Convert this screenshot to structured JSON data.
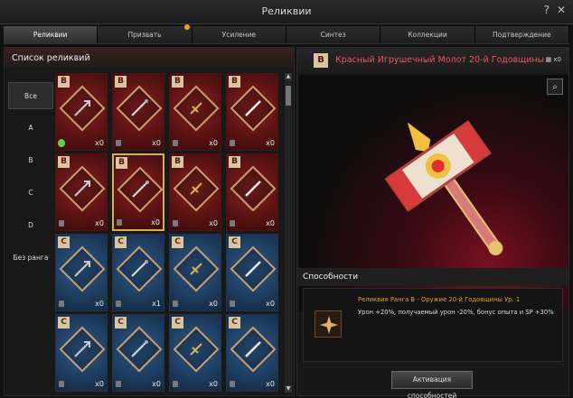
{
  "window": {
    "title": "Реликвии",
    "help": "?",
    "close": "✕"
  },
  "tabs": [
    {
      "label": "Реликвии",
      "active": true
    },
    {
      "label": "Призвать",
      "active": false,
      "notify": true
    },
    {
      "label": "Усиление",
      "active": false
    },
    {
      "label": "Синтез",
      "active": false
    },
    {
      "label": "Коллекции",
      "active": false
    },
    {
      "label": "Подтверждение",
      "active": false
    }
  ],
  "list": {
    "header": "Список реликвий",
    "ranks": [
      "Все",
      "A",
      "B",
      "C",
      "D",
      "Без ранга"
    ],
    "cards": [
      {
        "rank": "B",
        "color": "red",
        "qty": "x0",
        "gem": true
      },
      {
        "rank": "B",
        "color": "red",
        "qty": "x0"
      },
      {
        "rank": "B",
        "color": "red",
        "qty": "x0"
      },
      {
        "rank": "B",
        "color": "red",
        "qty": "x0"
      },
      {
        "rank": "B",
        "color": "red",
        "qty": "x0"
      },
      {
        "rank": "B",
        "color": "red",
        "qty": "x0",
        "selected": true
      },
      {
        "rank": "B",
        "color": "red",
        "qty": "x0"
      },
      {
        "rank": "B",
        "color": "red",
        "qty": "x0"
      },
      {
        "rank": "C",
        "color": "blue",
        "qty": "x0"
      },
      {
        "rank": "C",
        "color": "blue",
        "qty": "x1"
      },
      {
        "rank": "C",
        "color": "blue",
        "qty": "x0"
      },
      {
        "rank": "C",
        "color": "blue",
        "qty": "x0"
      },
      {
        "rank": "C",
        "color": "blue",
        "qty": "x0"
      },
      {
        "rank": "C",
        "color": "blue",
        "qty": "x0"
      },
      {
        "rank": "C",
        "color": "blue",
        "qty": "x0"
      },
      {
        "rank": "C",
        "color": "blue",
        "qty": "x0"
      }
    ]
  },
  "detail": {
    "rank": "B",
    "name": "Красный Игрушечный Молот 20-й Годовщины",
    "count": "x0",
    "abilities_header": "Способности",
    "ability_title": "Реликвия Ранга B - Оружие 20-й Годовщины Ур. 1",
    "ability_desc": "Урон +20%, получаемый урон -20%, бонус опыта и SP +30%",
    "activate_button": "Активация способностей"
  }
}
